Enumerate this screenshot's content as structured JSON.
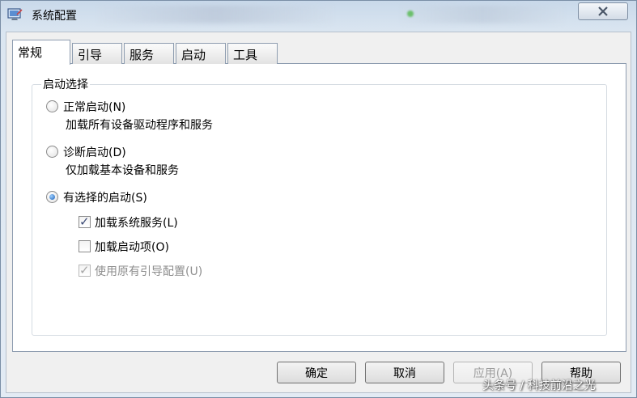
{
  "window": {
    "title": "系统配置"
  },
  "tabs": [
    {
      "label": "常规",
      "active": true
    },
    {
      "label": "引导",
      "active": false
    },
    {
      "label": "服务",
      "active": false
    },
    {
      "label": "启动",
      "active": false
    },
    {
      "label": "工具",
      "active": false
    }
  ],
  "startup": {
    "group_title": "启动选择",
    "options": [
      {
        "label": "正常启动(N)",
        "desc": "加载所有设备驱动程序和服务",
        "checked": false
      },
      {
        "label": "诊断启动(D)",
        "desc": "仅加载基本设备和服务",
        "checked": false
      },
      {
        "label": "有选择的启动(S)",
        "desc": "",
        "checked": true
      }
    ],
    "checkboxes": [
      {
        "label": "加载系统服务(L)",
        "checked": true,
        "disabled": false
      },
      {
        "label": "加载启动项(O)",
        "checked": false,
        "disabled": false
      },
      {
        "label": "使用原有引导配置(U)",
        "checked": true,
        "disabled": true
      }
    ]
  },
  "buttons": {
    "ok": "确定",
    "cancel": "取消",
    "apply": "应用(A)",
    "help": "帮助"
  },
  "watermark": "头条号 / 科技前沿之光",
  "icons": {
    "close": "close-icon",
    "check": "✓"
  }
}
